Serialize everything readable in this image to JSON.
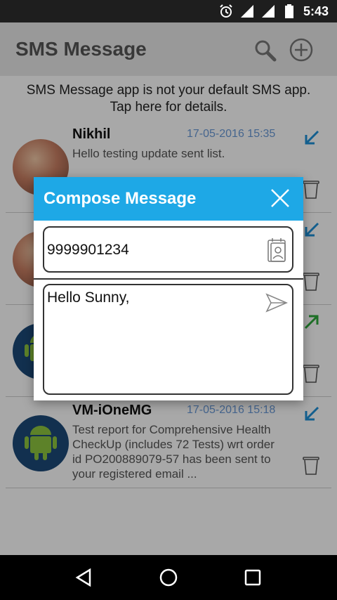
{
  "status_bar": {
    "time": "5:43",
    "icons": [
      "alarm-icon",
      "signal-icon",
      "signal-icon",
      "battery-icon"
    ]
  },
  "app_bar": {
    "title": "SMS Message",
    "actions": [
      "search-icon",
      "add-icon"
    ]
  },
  "banner": {
    "line1": "SMS Message app is not your default SMS app.",
    "line2": "Tap here for details."
  },
  "messages": [
    {
      "sender": "Nikhil",
      "date": "17-05-2016 15:35",
      "preview": "Hello testing update sent list.",
      "direction": "incoming",
      "avatar": "photo"
    },
    {
      "sender": "",
      "date": "",
      "preview": "",
      "direction": "incoming",
      "avatar": "photo"
    },
    {
      "sender": "",
      "date": "",
      "preview": "",
      "direction": "outgoing",
      "avatar": "android"
    },
    {
      "sender": "VM-iOneMG",
      "date": "17-05-2016 15:18",
      "preview": "Test report for Comprehensive Health CheckUp (includes 72 Tests) wrt order id PO200889079-57 has been sent to your registered email ...",
      "direction": "incoming",
      "avatar": "android"
    }
  ],
  "colors": {
    "dialog_header": "#1ea8e6",
    "date_text": "#6a9ad8",
    "incoming_arrow": "#1e90d8",
    "outgoing_arrow": "#2eaa3c"
  },
  "dialog": {
    "title": "Compose Message",
    "phone_value": "9999901234",
    "message_value": "Hello Sunny,"
  },
  "nav_bar": {
    "buttons": [
      "back-icon",
      "home-icon",
      "recents-icon"
    ]
  }
}
